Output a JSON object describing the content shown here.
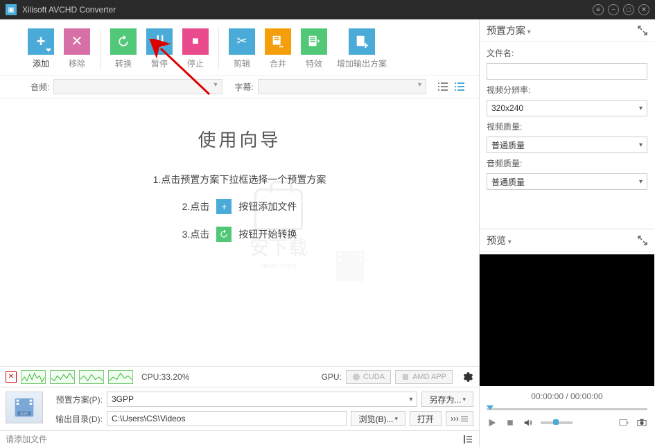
{
  "app": {
    "title": "Xilisoft AVCHD Converter"
  },
  "toolbar": {
    "add": "添加",
    "remove": "移除",
    "convert": "转换",
    "pause": "暂停",
    "stop": "停止",
    "cut": "剪辑",
    "merge": "合并",
    "effects": "特效",
    "addProfile": "增加输出方案"
  },
  "audioRow": {
    "audio": "音频:",
    "subtitle": "字幕:"
  },
  "wizard": {
    "title": "使用向导",
    "step1": "1.点击预置方案下拉框选择一个预置方案",
    "step2a": "2.点击",
    "step2b": "按钮添加文件",
    "step3a": "3.点击",
    "step3b": "按钮开始转换"
  },
  "watermark": {
    "text": "安下载",
    "sub": "anxz.com"
  },
  "cpu": {
    "label": "CPU:33.20%",
    "gpuLabel": "GPU:",
    "cuda": "CUDA",
    "amd": "AMD APP"
  },
  "bottom": {
    "profileLabel": "预置方案(P):",
    "profileValue": "3GPP",
    "saveAs": "另存为...",
    "outputLabel": "输出目录(D):",
    "outputValue": "C:\\Users\\CS\\Videos",
    "browse": "浏览(B)...",
    "open": "打开",
    "advanced": "›››"
  },
  "statusbar": {
    "hint": "请添加文件"
  },
  "preset": {
    "header": "预置方案",
    "fileNameLabel": "文件名:",
    "fileNameValue": "",
    "resLabel": "视频分辨率:",
    "resValue": "320x240",
    "vqLabel": "视频质量:",
    "vqValue": "普通质量",
    "aqLabel": "音频质量:",
    "aqValue": "普通质量"
  },
  "preview": {
    "header": "预览",
    "time": "00:00:00 / 00:00:00"
  }
}
